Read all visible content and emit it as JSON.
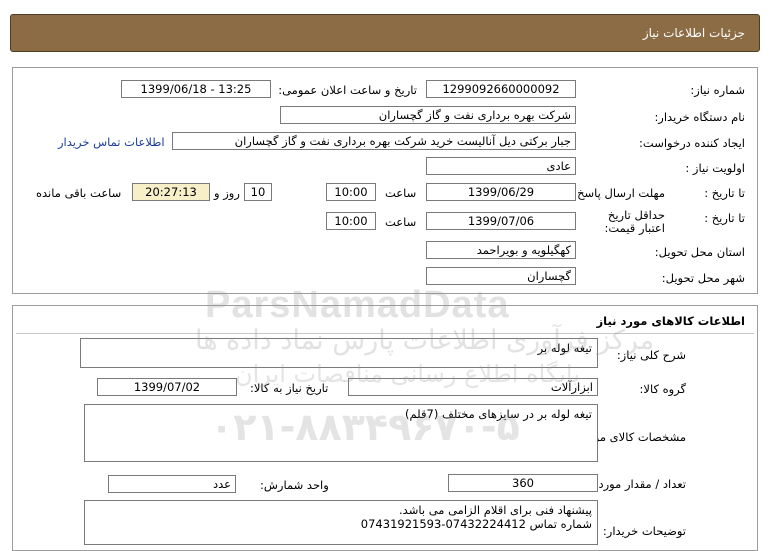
{
  "header": {
    "title": "جزئیات اطلاعات نیاز"
  },
  "details": {
    "need_number": {
      "label": "شماره نیاز:",
      "value": "1299092660000092"
    },
    "announce_date": {
      "label": "تاریخ و ساعت اعلان عمومی:",
      "value": "1399/06/18 - 13:25"
    },
    "buyer_org": {
      "label": "نام دستگاه خریدار:",
      "value": "شرکت بهره برداری نفت و گاز گچساران"
    },
    "requester": {
      "label": "ایجاد کننده درخواست:",
      "value": "جبار برکتی دیل آنالیست خرید شرکت بهره برداری نفت و گاز گچساران"
    },
    "contact_link": "اطلاعات تماس خریدار",
    "priority": {
      "label": "اولویت نیاز :",
      "value": "عادی"
    },
    "response_deadline": {
      "label": "مهلت ارسال پاسخ:",
      "to_date_label": "تا تاریخ :",
      "date": "1399/06/29",
      "time_label": "ساعت",
      "time": "10:00",
      "days": "10",
      "days_label": "روز و",
      "remaining": "20:27:13",
      "remaining_label": "ساعت باقی مانده"
    },
    "price_validity": {
      "label": "حداقل تاریخ اعتبار قیمت:",
      "to_date_label": "تا تاریخ :",
      "date": "1399/07/06",
      "time_label": "ساعت",
      "time": "10:00"
    },
    "province": {
      "label": "استان محل تحویل:",
      "value": "کهگیلویه و بویراحمد"
    },
    "city": {
      "label": "شهر محل تحویل:",
      "value": "گچساران"
    }
  },
  "goods": {
    "title": "اطلاعات کالاهای مورد نیاز",
    "summary": {
      "label": "شرح کلی نیاز:",
      "value": "تیغه لوله بر"
    },
    "group": {
      "label": "گروه کالا:",
      "value": "ابزارآلات"
    },
    "need_date": {
      "label": "تاریخ نیاز به کالا:",
      "value": "1399/07/02"
    },
    "specs": {
      "label": "مشخصات کالای مورد نیاز:",
      "value": "تیغه لوله بر در سایزهای مختلف (7قلم)"
    },
    "quantity": {
      "label": "تعداد / مقدار مورد نیاز:",
      "value": "360"
    },
    "unit": {
      "label": "واحد شمارش:",
      "value": "عدد"
    },
    "buyer_notes": {
      "label": "توضیحات خریدار:",
      "line1": "پیشنهاد فنی برای اقلام الزامی می باشد.",
      "line2": "شماره تماس 07432224412-07431921593"
    }
  },
  "watermark": {
    "brand": "ParsNamadData",
    "line1": "مرکز فرآوری اطلاعات پارس نماد داده ها",
    "line2": "پایگاه اطلاع رسانی مناقصات ایران",
    "phone": "۰۲۱-۸۸۳۴۹۶۷۰-۵"
  }
}
